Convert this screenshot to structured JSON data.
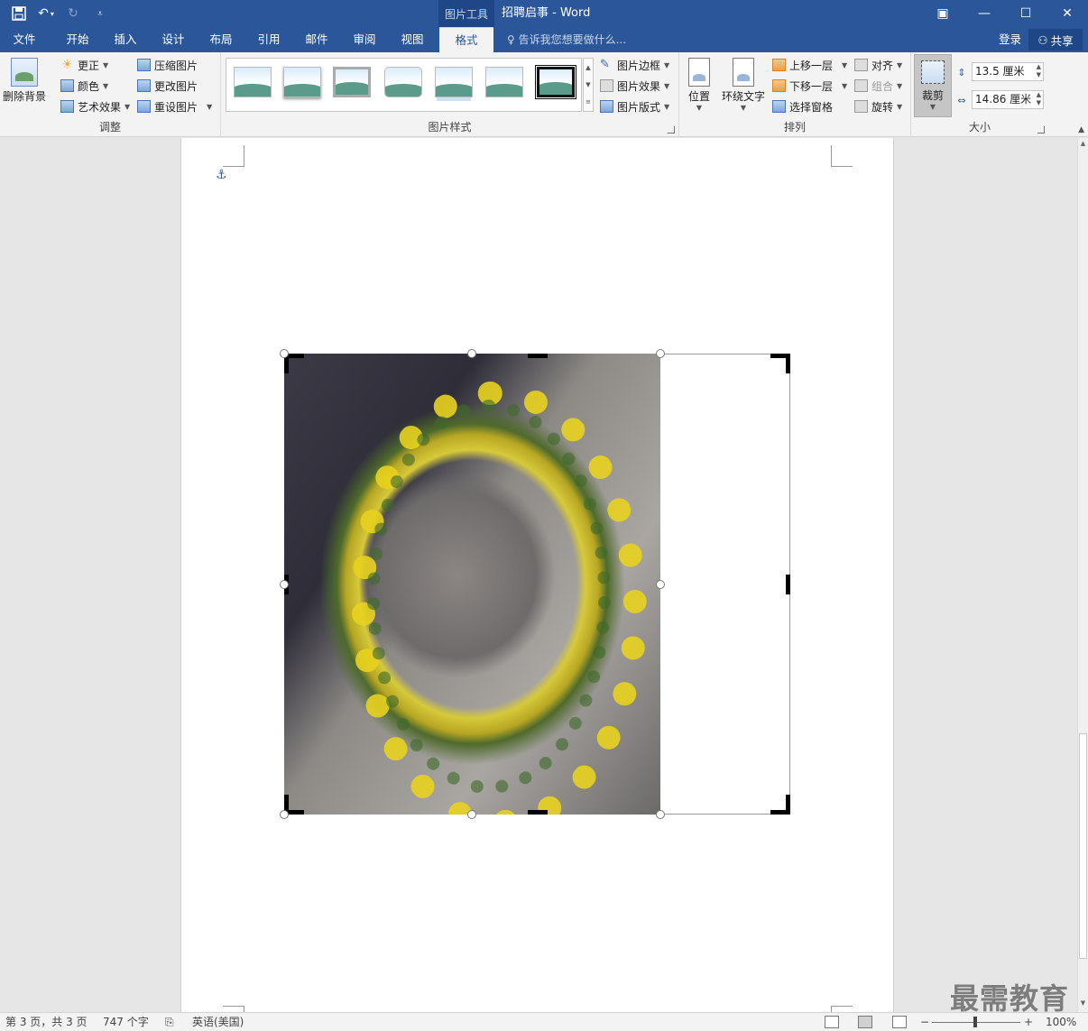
{
  "titlebar": {
    "context_tools": "图片工具",
    "doc_title": "招聘启事 - Word",
    "qat": {
      "save_icon": "save-icon",
      "undo_icon": "undo-icon",
      "redo_icon": "redo-icon",
      "customize_icon": "customize-qat-icon"
    },
    "window": {
      "ribbon_opts": "▣",
      "minimize": "—",
      "maximize": "☐",
      "close": "✕"
    }
  },
  "tabs": [
    {
      "label": "文件"
    },
    {
      "label": "开始"
    },
    {
      "label": "插入"
    },
    {
      "label": "设计"
    },
    {
      "label": "布局"
    },
    {
      "label": "引用"
    },
    {
      "label": "邮件"
    },
    {
      "label": "审阅"
    },
    {
      "label": "视图"
    },
    {
      "label": "格式",
      "active": true
    }
  ],
  "tell_me": "告诉我您想要做什么...",
  "account": {
    "login": "登录",
    "share": "共享"
  },
  "ribbon": {
    "adjust": {
      "label": "调整",
      "remove_bg": "删除背景",
      "corrections": "更正",
      "color": "颜色",
      "artistic": "艺术效果",
      "compress": "压缩图片",
      "change": "更改图片",
      "reset": "重设图片"
    },
    "styles": {
      "label": "图片样式",
      "border": "图片边框",
      "effects": "图片效果",
      "layout": "图片版式"
    },
    "arrange": {
      "label": "排列",
      "position": "位置",
      "wrap": "环绕文字",
      "forward": "上移一层",
      "backward": "下移一层",
      "selection": "选择窗格",
      "align": "对齐",
      "group": "组合",
      "rotate": "旋转"
    },
    "size": {
      "label": "大小",
      "crop": "裁剪",
      "height": "13.5 厘米",
      "width": "14.86 厘米"
    }
  },
  "status": {
    "page": "第 3 页，共 3 页",
    "words": "747 个字",
    "language": "英语(美国)",
    "zoom": "100%",
    "zoom_minus": "−",
    "zoom_plus": "+"
  },
  "watermark": "最需教育"
}
